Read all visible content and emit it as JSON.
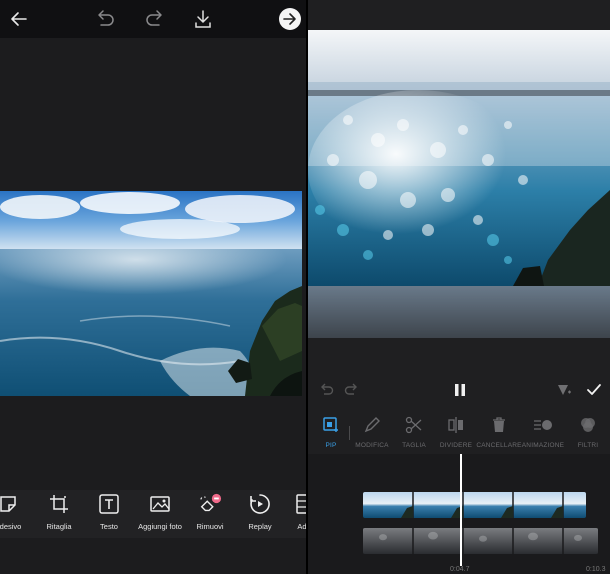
{
  "editor": {
    "toolbar": [
      {
        "id": "adesivo",
        "label": "Adesivo",
        "icon": "sticker-icon"
      },
      {
        "id": "ritaglia",
        "label": "Ritaglia",
        "icon": "crop-icon"
      },
      {
        "id": "testo",
        "label": "Testo",
        "icon": "text-icon"
      },
      {
        "id": "aggiungi-foto",
        "label": "Aggiungi foto",
        "icon": "add-photo-icon"
      },
      {
        "id": "rimuovi",
        "label": "Rimuovi",
        "icon": "eraser-icon"
      },
      {
        "id": "replay",
        "label": "Replay",
        "icon": "replay-icon"
      },
      {
        "id": "ad",
        "label": "Ad",
        "icon": "adjust-icon"
      }
    ],
    "top_icons": [
      "back-arrow-icon",
      "undo-icon",
      "redo-icon",
      "download-icon",
      "next-arrow-icon"
    ]
  },
  "video_editor": {
    "tabs": [
      {
        "id": "pip",
        "label": "PIP",
        "active": true
      },
      {
        "id": "modifica",
        "label": "MODIFICA"
      },
      {
        "id": "taglia",
        "label": "TAGLIA"
      },
      {
        "id": "dividere",
        "label": "DIVIDERE"
      },
      {
        "id": "cancellare",
        "label": "CANCELLARE"
      },
      {
        "id": "animazione",
        "label": "ANIMAZIONE"
      },
      {
        "id": "filtri",
        "label": "FILTRI"
      }
    ],
    "time_current": "0:04.7",
    "time_end": "0:10.3",
    "accent_color": "#3aa0e8"
  }
}
